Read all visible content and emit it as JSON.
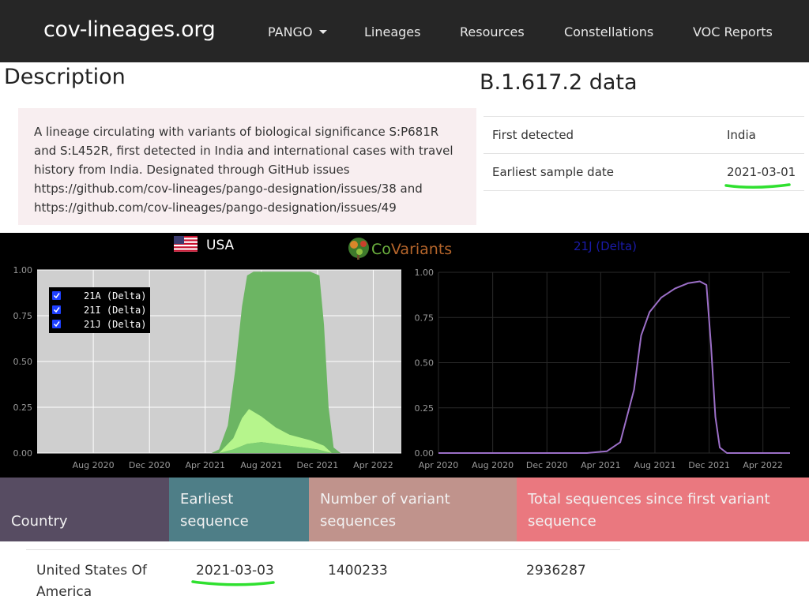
{
  "nav": {
    "brand": "cov-lineages.org",
    "items": [
      "PANGO",
      "Lineages",
      "Resources",
      "Constellations",
      "VOC Reports"
    ]
  },
  "description": {
    "heading": "Description",
    "lines": [
      "A lineage circulating with variants of biological significance S:P681R",
      "and S:L452R, first detected in India and international cases with travel",
      "history from India. Designated through GitHub issues",
      "https://github.com/cov-lineages/pango-designation/issues/38 and",
      "https://github.com/cov-lineages/pango-designation/issues/49"
    ]
  },
  "lineage_data": {
    "heading": "B.1.617.2 data",
    "rows": [
      {
        "label": "First detected",
        "value": "India"
      },
      {
        "label": "Earliest sample date",
        "value": "2021-03-01"
      }
    ]
  },
  "covariants": {
    "logo_prefix": "Co",
    "logo_suffix": "Variants",
    "left_title": "USA",
    "right_title": "21J (Delta)",
    "legend": [
      "21A (Delta)",
      "21I (Delta)",
      "21J (Delta)"
    ]
  },
  "chart_data": [
    {
      "type": "area",
      "title": "USA",
      "series": [
        {
          "name": "21A (Delta)",
          "color": "#7fcf73"
        },
        {
          "name": "21I (Delta)",
          "color": "#b6f58c"
        },
        {
          "name": "21J (Delta)",
          "color": "#6cb563"
        }
      ],
      "x_ticks": [
        "Aug 2020",
        "Dec 2020",
        "Apr 2021",
        "Aug 2021",
        "Dec 2021",
        "Apr 2022"
      ],
      "y_ticks": [
        "0.00",
        "0.25",
        "0.50",
        "0.75",
        "1.00"
      ],
      "ylim": [
        0,
        1
      ],
      "stacked_top": [
        [
          "2021-04-15",
          0
        ],
        [
          "2021-05-01",
          0.02
        ],
        [
          "2021-05-20",
          0.15
        ],
        [
          "2021-06-05",
          0.45
        ],
        [
          "2021-06-20",
          0.8
        ],
        [
          "2021-07-01",
          0.97
        ],
        [
          "2021-07-15",
          0.99
        ],
        [
          "2021-11-15",
          0.99
        ],
        [
          "2021-12-05",
          0.97
        ],
        [
          "2021-12-15",
          0.7
        ],
        [
          "2021-12-25",
          0.25
        ],
        [
          "2022-01-05",
          0.03
        ],
        [
          "2022-01-20",
          0
        ]
      ],
      "band_21I_top": [
        [
          "2021-05-01",
          0
        ],
        [
          "2021-06-01",
          0.08
        ],
        [
          "2021-06-20",
          0.19
        ],
        [
          "2021-07-05",
          0.24
        ],
        [
          "2021-08-01",
          0.2
        ],
        [
          "2021-09-01",
          0.14
        ],
        [
          "2021-10-01",
          0.1
        ],
        [
          "2021-11-15",
          0.07
        ],
        [
          "2021-12-15",
          0.04
        ],
        [
          "2022-01-01",
          0
        ]
      ],
      "band_21I_bottom": [
        [
          "2021-05-01",
          0
        ],
        [
          "2021-06-01",
          0.02
        ],
        [
          "2021-07-01",
          0.05
        ],
        [
          "2021-08-01",
          0.06
        ],
        [
          "2021-10-01",
          0.04
        ],
        [
          "2021-12-01",
          0.02
        ],
        [
          "2022-01-01",
          0
        ]
      ]
    },
    {
      "type": "line",
      "title": "21J (Delta)",
      "series": [
        {
          "name": "21J (Delta)",
          "color": "#9c6fc8"
        }
      ],
      "x_ticks": [
        "Apr 2020",
        "Aug 2020",
        "Dec 2020",
        "Apr 2021",
        "Aug 2021",
        "Dec 2021",
        "Apr 2022"
      ],
      "y_ticks": [
        "0.00",
        "0.25",
        "0.50",
        "0.75",
        "1.00"
      ],
      "ylim": [
        0,
        1
      ],
      "points": [
        [
          "2020-04-01",
          0
        ],
        [
          "2021-03-01",
          0
        ],
        [
          "2021-04-15",
          0.01
        ],
        [
          "2021-05-15",
          0.06
        ],
        [
          "2021-06-15",
          0.35
        ],
        [
          "2021-07-01",
          0.65
        ],
        [
          "2021-07-20",
          0.78
        ],
        [
          "2021-08-15",
          0.86
        ],
        [
          "2021-09-15",
          0.91
        ],
        [
          "2021-10-15",
          0.94
        ],
        [
          "2021-11-10",
          0.95
        ],
        [
          "2021-11-25",
          0.93
        ],
        [
          "2021-12-05",
          0.6
        ],
        [
          "2021-12-15",
          0.2
        ],
        [
          "2021-12-25",
          0.03
        ],
        [
          "2022-01-10",
          0
        ],
        [
          "2022-06-01",
          0
        ]
      ]
    }
  ],
  "country_table": {
    "headers": [
      "Country",
      "Earliest sequence",
      "Number of variant sequences",
      "Total sequences since first variant sequence"
    ],
    "header_colors": [
      "#574c62",
      "#4e7e87",
      "#c0938c",
      "#ea787f"
    ],
    "row": [
      "United States Of America",
      "2021-03-03",
      "1400233",
      "2936287"
    ]
  },
  "highlight_color": "#2fe02f"
}
